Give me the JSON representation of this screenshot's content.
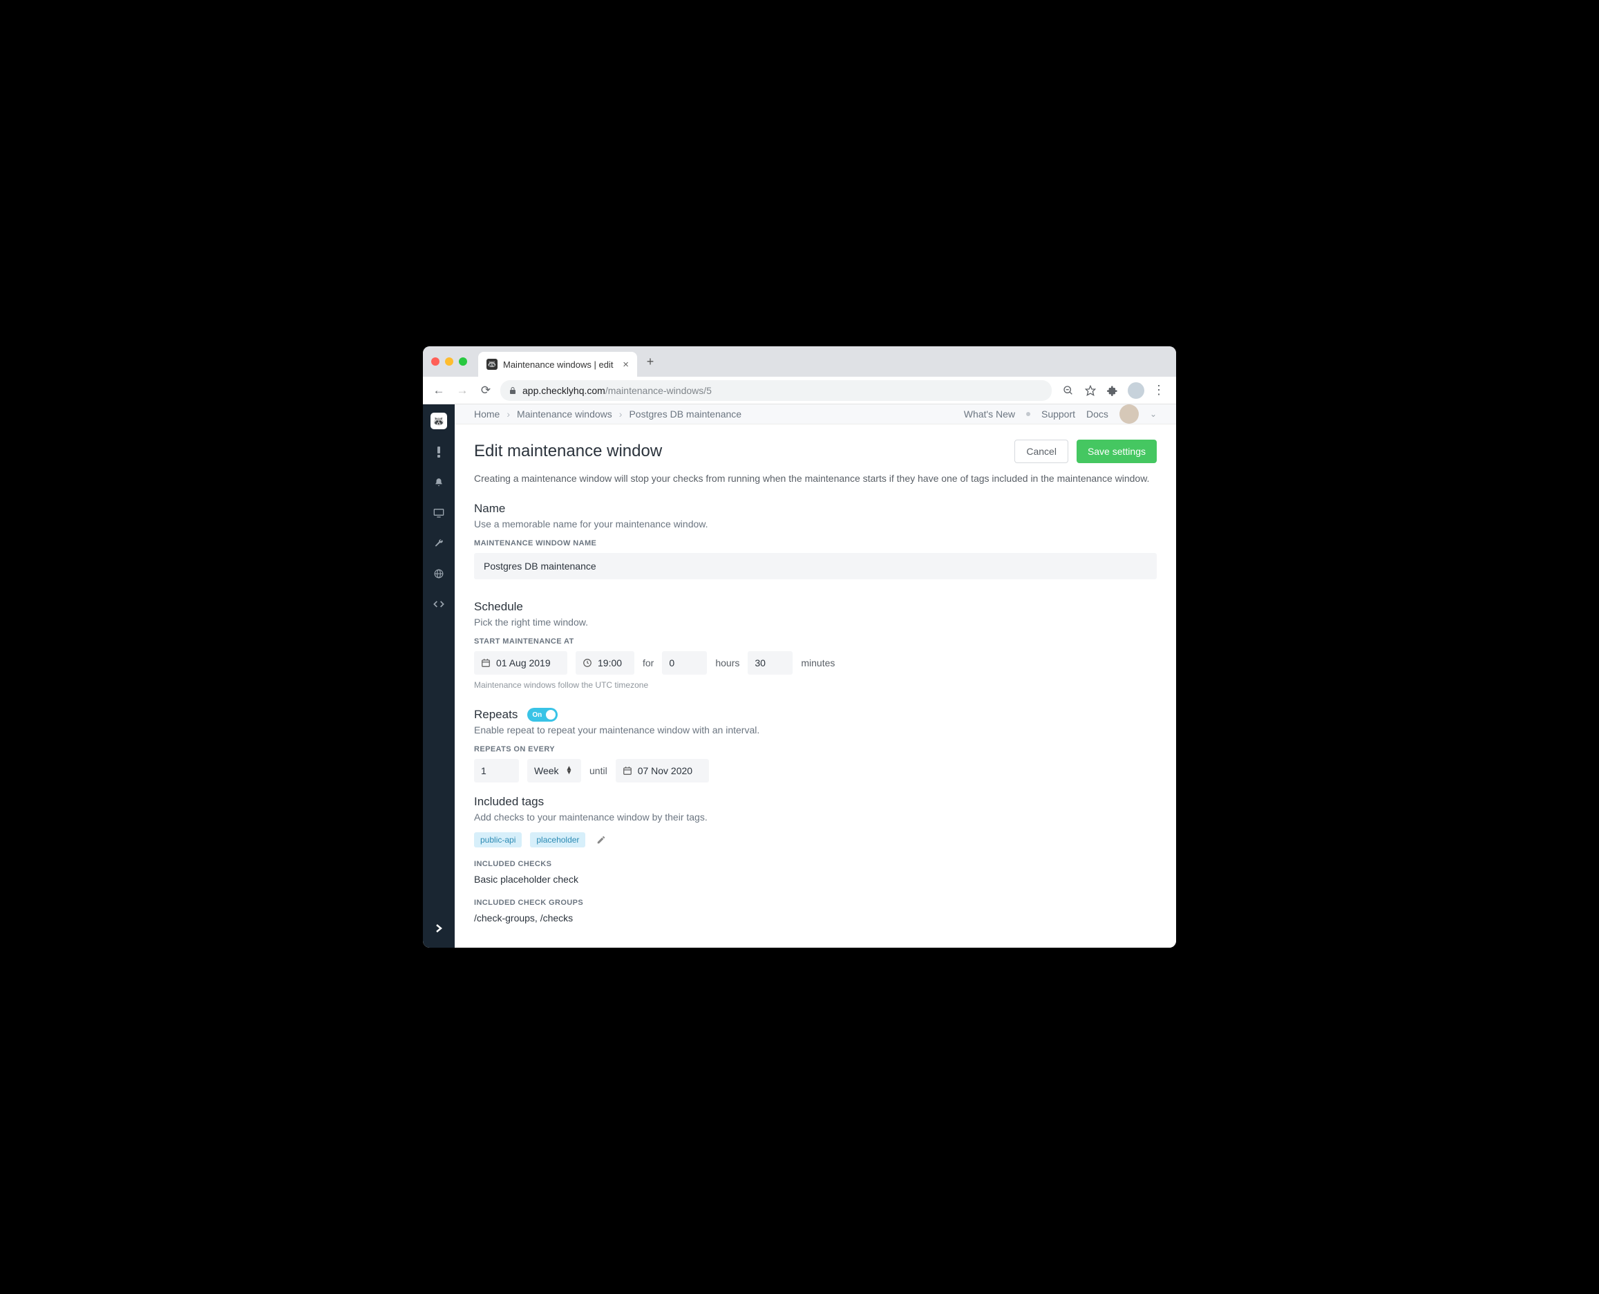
{
  "browser": {
    "tab_title": "Maintenance windows | edit",
    "url_host": "app.checklyhq.com",
    "url_path": "/maintenance-windows/5"
  },
  "breadcrumb": {
    "home": "Home",
    "level1": "Maintenance windows",
    "level2": "Postgres DB maintenance"
  },
  "topnav": {
    "whatsnew": "What's New",
    "support": "Support",
    "docs": "Docs"
  },
  "page": {
    "title": "Edit maintenance window",
    "cancel": "Cancel",
    "save": "Save settings",
    "desc": "Creating a maintenance window will stop your checks from running when the maintenance starts if they have one of tags included in the maintenance window."
  },
  "name": {
    "heading": "Name",
    "sub": "Use a memorable name for your maintenance window.",
    "label": "MAINTENANCE WINDOW NAME",
    "value": "Postgres DB maintenance"
  },
  "schedule": {
    "heading": "Schedule",
    "sub": "Pick the right time window.",
    "label": "START MAINTENANCE AT",
    "date": "01 Aug 2019",
    "time": "19:00",
    "for": "for",
    "hours_value": "0",
    "hours_label": "hours",
    "minutes_value": "30",
    "minutes_label": "minutes",
    "helper": "Maintenance windows follow the UTC timezone"
  },
  "repeats": {
    "heading": "Repeats",
    "toggle_label": "On",
    "sub": "Enable repeat to repeat your maintenance window with an interval.",
    "label": "REPEATS ON EVERY",
    "interval": "1",
    "unit": "Week",
    "until": "until",
    "end_date": "07 Nov 2020"
  },
  "tags": {
    "heading": "Included tags",
    "sub": "Add checks to your maintenance window by their tags.",
    "list": [
      "public-api",
      "placeholder"
    ],
    "checks_label": "INCLUDED CHECKS",
    "checks_value": "Basic placeholder check",
    "groups_label": "INCLUDED CHECK GROUPS",
    "groups_value": "/check-groups,  /checks"
  }
}
